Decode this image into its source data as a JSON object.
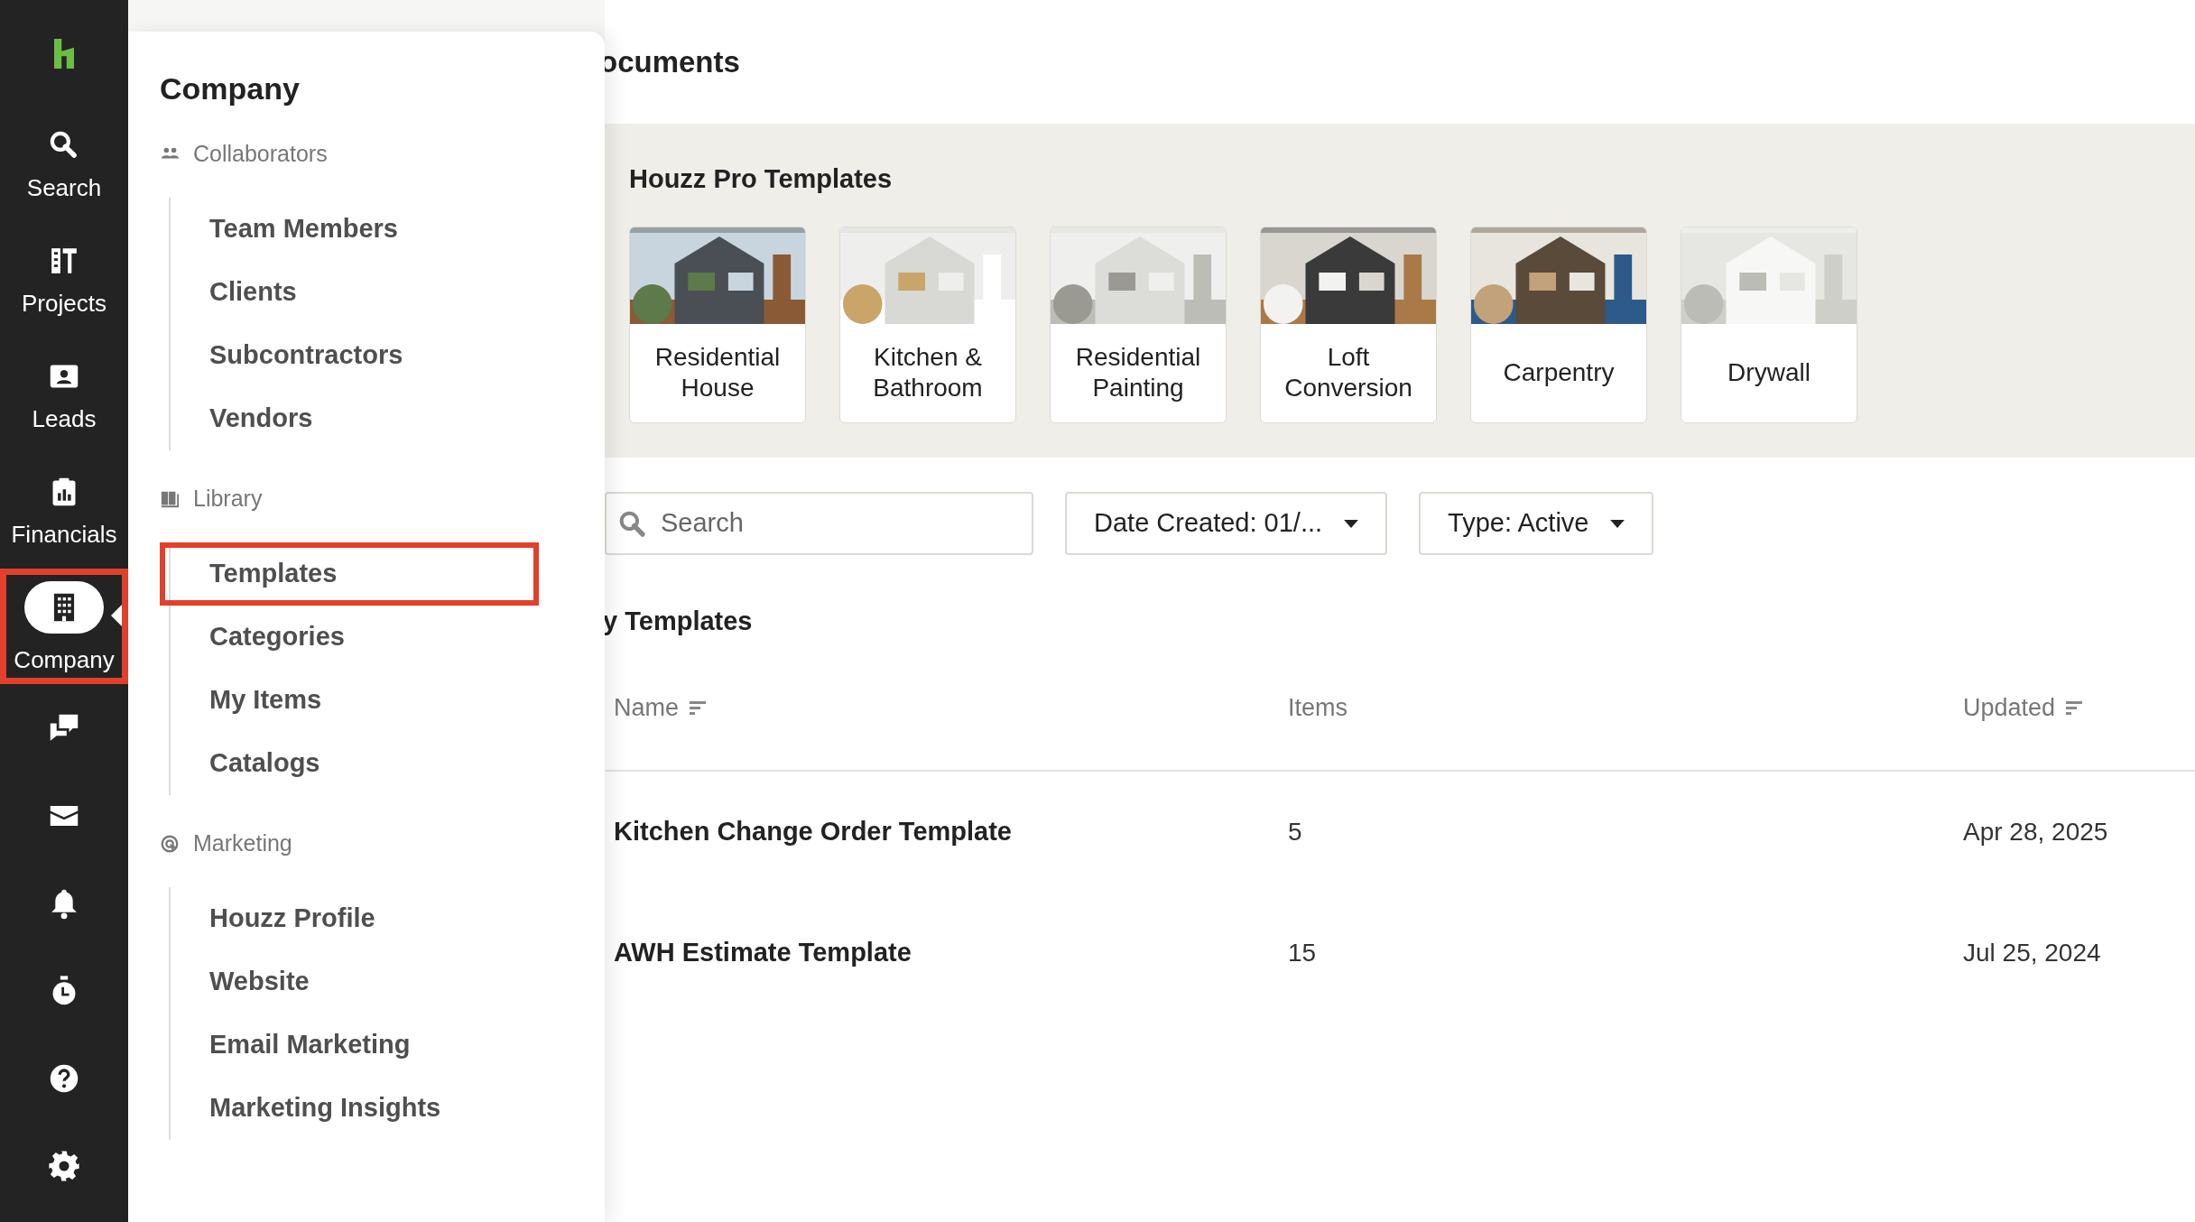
{
  "rail": {
    "logo": true,
    "items": [
      {
        "kind": "search",
        "label": "Search",
        "selected": false,
        "highlighted": false
      },
      {
        "kind": "projects",
        "label": "Projects",
        "selected": false,
        "highlighted": false
      },
      {
        "kind": "leads",
        "label": "Leads",
        "selected": false,
        "highlighted": false
      },
      {
        "kind": "financials",
        "label": "Financials",
        "selected": false,
        "highlighted": false
      },
      {
        "kind": "company",
        "label": "Company",
        "selected": true,
        "highlighted": true
      },
      {
        "kind": "messages",
        "selected": false,
        "highlighted": false
      },
      {
        "kind": "mail",
        "selected": false,
        "highlighted": false
      },
      {
        "kind": "notifications",
        "selected": false,
        "highlighted": false
      },
      {
        "kind": "timer",
        "selected": false,
        "highlighted": false
      },
      {
        "kind": "help",
        "selected": false,
        "highlighted": false
      },
      {
        "kind": "settings",
        "selected": false,
        "highlighted": false
      }
    ]
  },
  "flyout": {
    "title": "Company",
    "sections": [
      {
        "kind": "people",
        "label": "Collaborators",
        "items": [
          {
            "label": "Team Members",
            "highlighted": false
          },
          {
            "label": "Clients",
            "highlighted": false
          },
          {
            "label": "Subcontractors",
            "highlighted": false
          },
          {
            "label": "Vendors",
            "highlighted": false
          }
        ]
      },
      {
        "kind": "books",
        "label": "Library",
        "items": [
          {
            "label": "Templates",
            "highlighted": true
          },
          {
            "label": "Categories",
            "highlighted": false
          },
          {
            "label": "My Items",
            "highlighted": false
          },
          {
            "label": "Catalogs",
            "highlighted": false
          }
        ]
      },
      {
        "kind": "target",
        "label": "Marketing",
        "items": [
          {
            "label": "Houzz Profile",
            "highlighted": false
          },
          {
            "label": "Website",
            "highlighted": false
          },
          {
            "label": "Email Marketing",
            "highlighted": false
          },
          {
            "label": "Marketing Insights",
            "highlighted": false
          }
        ]
      }
    ]
  },
  "page": {
    "title": "ocuments",
    "pro_templates": {
      "title": "Houzz Pro Templates",
      "cards": [
        {
          "label": "Residential House",
          "kind": "picture"
        },
        {
          "label": "Kitchen & Bathroom",
          "kind": "picture"
        },
        {
          "label": "Residential Painting",
          "kind": "picture"
        },
        {
          "label": "Loft Conversion",
          "kind": "picture"
        },
        {
          "label": "Carpentry",
          "kind": "picture"
        },
        {
          "label": "Drywall",
          "kind": "picture"
        }
      ]
    },
    "filters": {
      "search": {
        "placeholder": "Search"
      },
      "dropdowns": [
        {
          "label": "Date Created: 01/..."
        },
        {
          "label": "Type: Active"
        }
      ]
    },
    "my_templates": {
      "title": "y Templates",
      "columns": [
        {
          "label": "Name",
          "sortable": true
        },
        {
          "label": "Items",
          "sortable": false
        },
        {
          "label": "Updated",
          "sortable": true
        }
      ],
      "rows": [
        [
          "Kitchen Change Order Template",
          "5",
          "Apr 28, 2025"
        ],
        [
          "AWH Estimate Template",
          "15",
          "Jul 25, 2024"
        ]
      ]
    }
  }
}
